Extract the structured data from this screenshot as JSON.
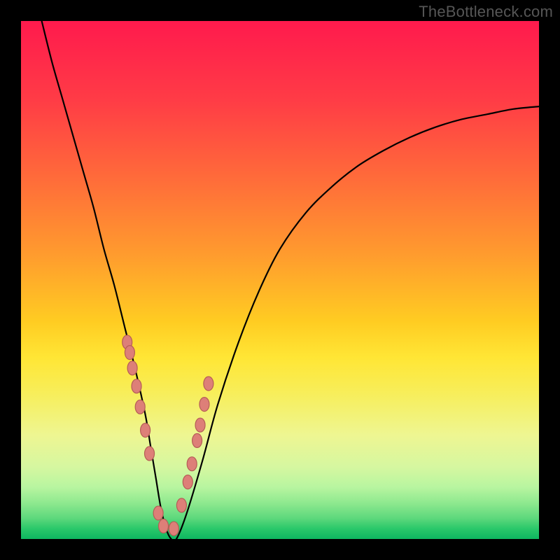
{
  "watermark_text": "TheBottleneck.com",
  "colors": {
    "background": "#000000",
    "marker_fill": "#dd7f78",
    "marker_stroke": "#b55d56",
    "curve_stroke": "#000000",
    "gradient_stops": [
      "#ff1a4d",
      "#ff3b46",
      "#ff6a3a",
      "#ff9b2e",
      "#ffcc22",
      "#ffe635",
      "#f7ee5b",
      "#eef692",
      "#d6f7a0",
      "#b8f5a0",
      "#8fe98f",
      "#5dd87c",
      "#2ac86a",
      "#0eb760"
    ]
  },
  "chart_data": {
    "type": "line",
    "title": "",
    "xlabel": "",
    "ylabel": "",
    "xlim": [
      0,
      100
    ],
    "ylim": [
      0,
      100
    ],
    "x": [
      4,
      6,
      8,
      10,
      12,
      14,
      16,
      18,
      20,
      22,
      24,
      25,
      26,
      27,
      28,
      29,
      30,
      32,
      35,
      38,
      42,
      46,
      50,
      55,
      60,
      65,
      70,
      75,
      80,
      85,
      90,
      95,
      100
    ],
    "y": [
      100,
      92,
      85,
      78,
      71,
      64,
      56,
      49,
      41,
      33,
      24,
      18,
      12,
      6,
      2,
      0,
      0,
      5,
      15,
      26,
      38,
      48,
      56,
      63,
      68,
      72,
      75,
      77.5,
      79.5,
      81,
      82,
      83,
      83.5
    ],
    "series": [
      {
        "name": "markers",
        "x": [
          20.5,
          21.0,
          21.5,
          22.3,
          23.0,
          24.0,
          24.8,
          26.5,
          27.5,
          29.5,
          31.0,
          32.2,
          33.0,
          34.0,
          34.6,
          35.4,
          36.2
        ],
        "y": [
          38,
          36,
          33,
          29.5,
          25.5,
          21,
          16.5,
          5,
          2.5,
          2,
          6.5,
          11,
          14.5,
          19,
          22,
          26,
          30
        ]
      }
    ]
  }
}
